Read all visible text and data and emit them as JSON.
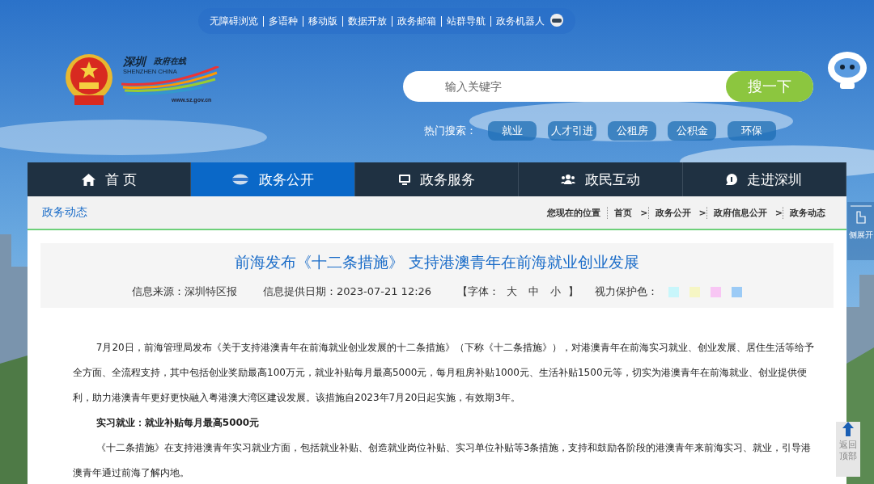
{
  "top_links": [
    "无障碍浏览",
    "多语种",
    "移动版",
    "数据开放",
    "政务邮箱",
    "站群导航",
    "政务机器人"
  ],
  "logo": {
    "name_cn": "深圳",
    "sub": "政府在线",
    "name_en": "SHENZHEN CHINA",
    "url": "www.sz.gov.cn"
  },
  "search": {
    "placeholder": "输入关键字",
    "button": "搜一下"
  },
  "hot_search": {
    "label": "热门搜索：",
    "tags": [
      "就业",
      "人才引进",
      "公租房",
      "公积金",
      "环保"
    ]
  },
  "nav": [
    {
      "label": "首 页",
      "selected": false
    },
    {
      "label": "政务公开",
      "selected": true
    },
    {
      "label": "政务服务",
      "selected": false
    },
    {
      "label": "政民互动",
      "selected": false
    },
    {
      "label": "走进深圳",
      "selected": false
    }
  ],
  "breadcrumb": {
    "section": "政务动态",
    "label": "您现在的位置",
    "separator": ">",
    "items": [
      "首页",
      "政务公开",
      "政府信息公开",
      "政务动态"
    ]
  },
  "article": {
    "title": "前海发布《十二条措施》 支持港澳青年在前海就业创业发展",
    "source_label": "信息来源：",
    "source": "深圳特区报",
    "date_label": "信息提供日期：",
    "date": "2023-07-21 12:26",
    "font_open": "【字体：",
    "font_sizes": [
      "大",
      "中",
      "小"
    ],
    "font_close": "】",
    "eye_label": "视力保护色：",
    "eye_colors": [
      {
        "color": "#c8f6fb"
      },
      {
        "color": "#f6f6c4"
      },
      {
        "color": "#f8c6f4"
      },
      {
        "color": "#9ccbf6"
      }
    ],
    "paragraphs": [
      {
        "kind": "text",
        "text": "7月20日，前海管理局发布《关于支持港澳青年在前海就业创业发展的十二条措施》（下称《十二条措施》），对港澳青年在前海实习就业、创业发展、居住生活等给予全方面、全流程支持，其中包括创业奖励最高100万元，就业补贴每月最高5000元，每月租房补贴1000元、生活补贴1500元等，切实为港澳青年在前海就业、创业提供便利，助力港澳青年更好更快融入粤港澳大湾区建设发展。该措施自2023年7月20日起实施，有效期3年。"
      },
      {
        "kind": "heading",
        "text": "实习就业：就业补贴每月最高5000元"
      },
      {
        "kind": "text",
        "text": "《十二条措施》在支持港澳青年实习就业方面，包括就业补贴、创造就业岗位补贴、实习单位补贴等3条措施，支持和鼓励各阶段的港澳青年来前海实习、就业，引导港澳青年通过前海了解内地。"
      }
    ]
  },
  "side": {
    "expand": "侧展开",
    "back_top": "返回顶部"
  }
}
